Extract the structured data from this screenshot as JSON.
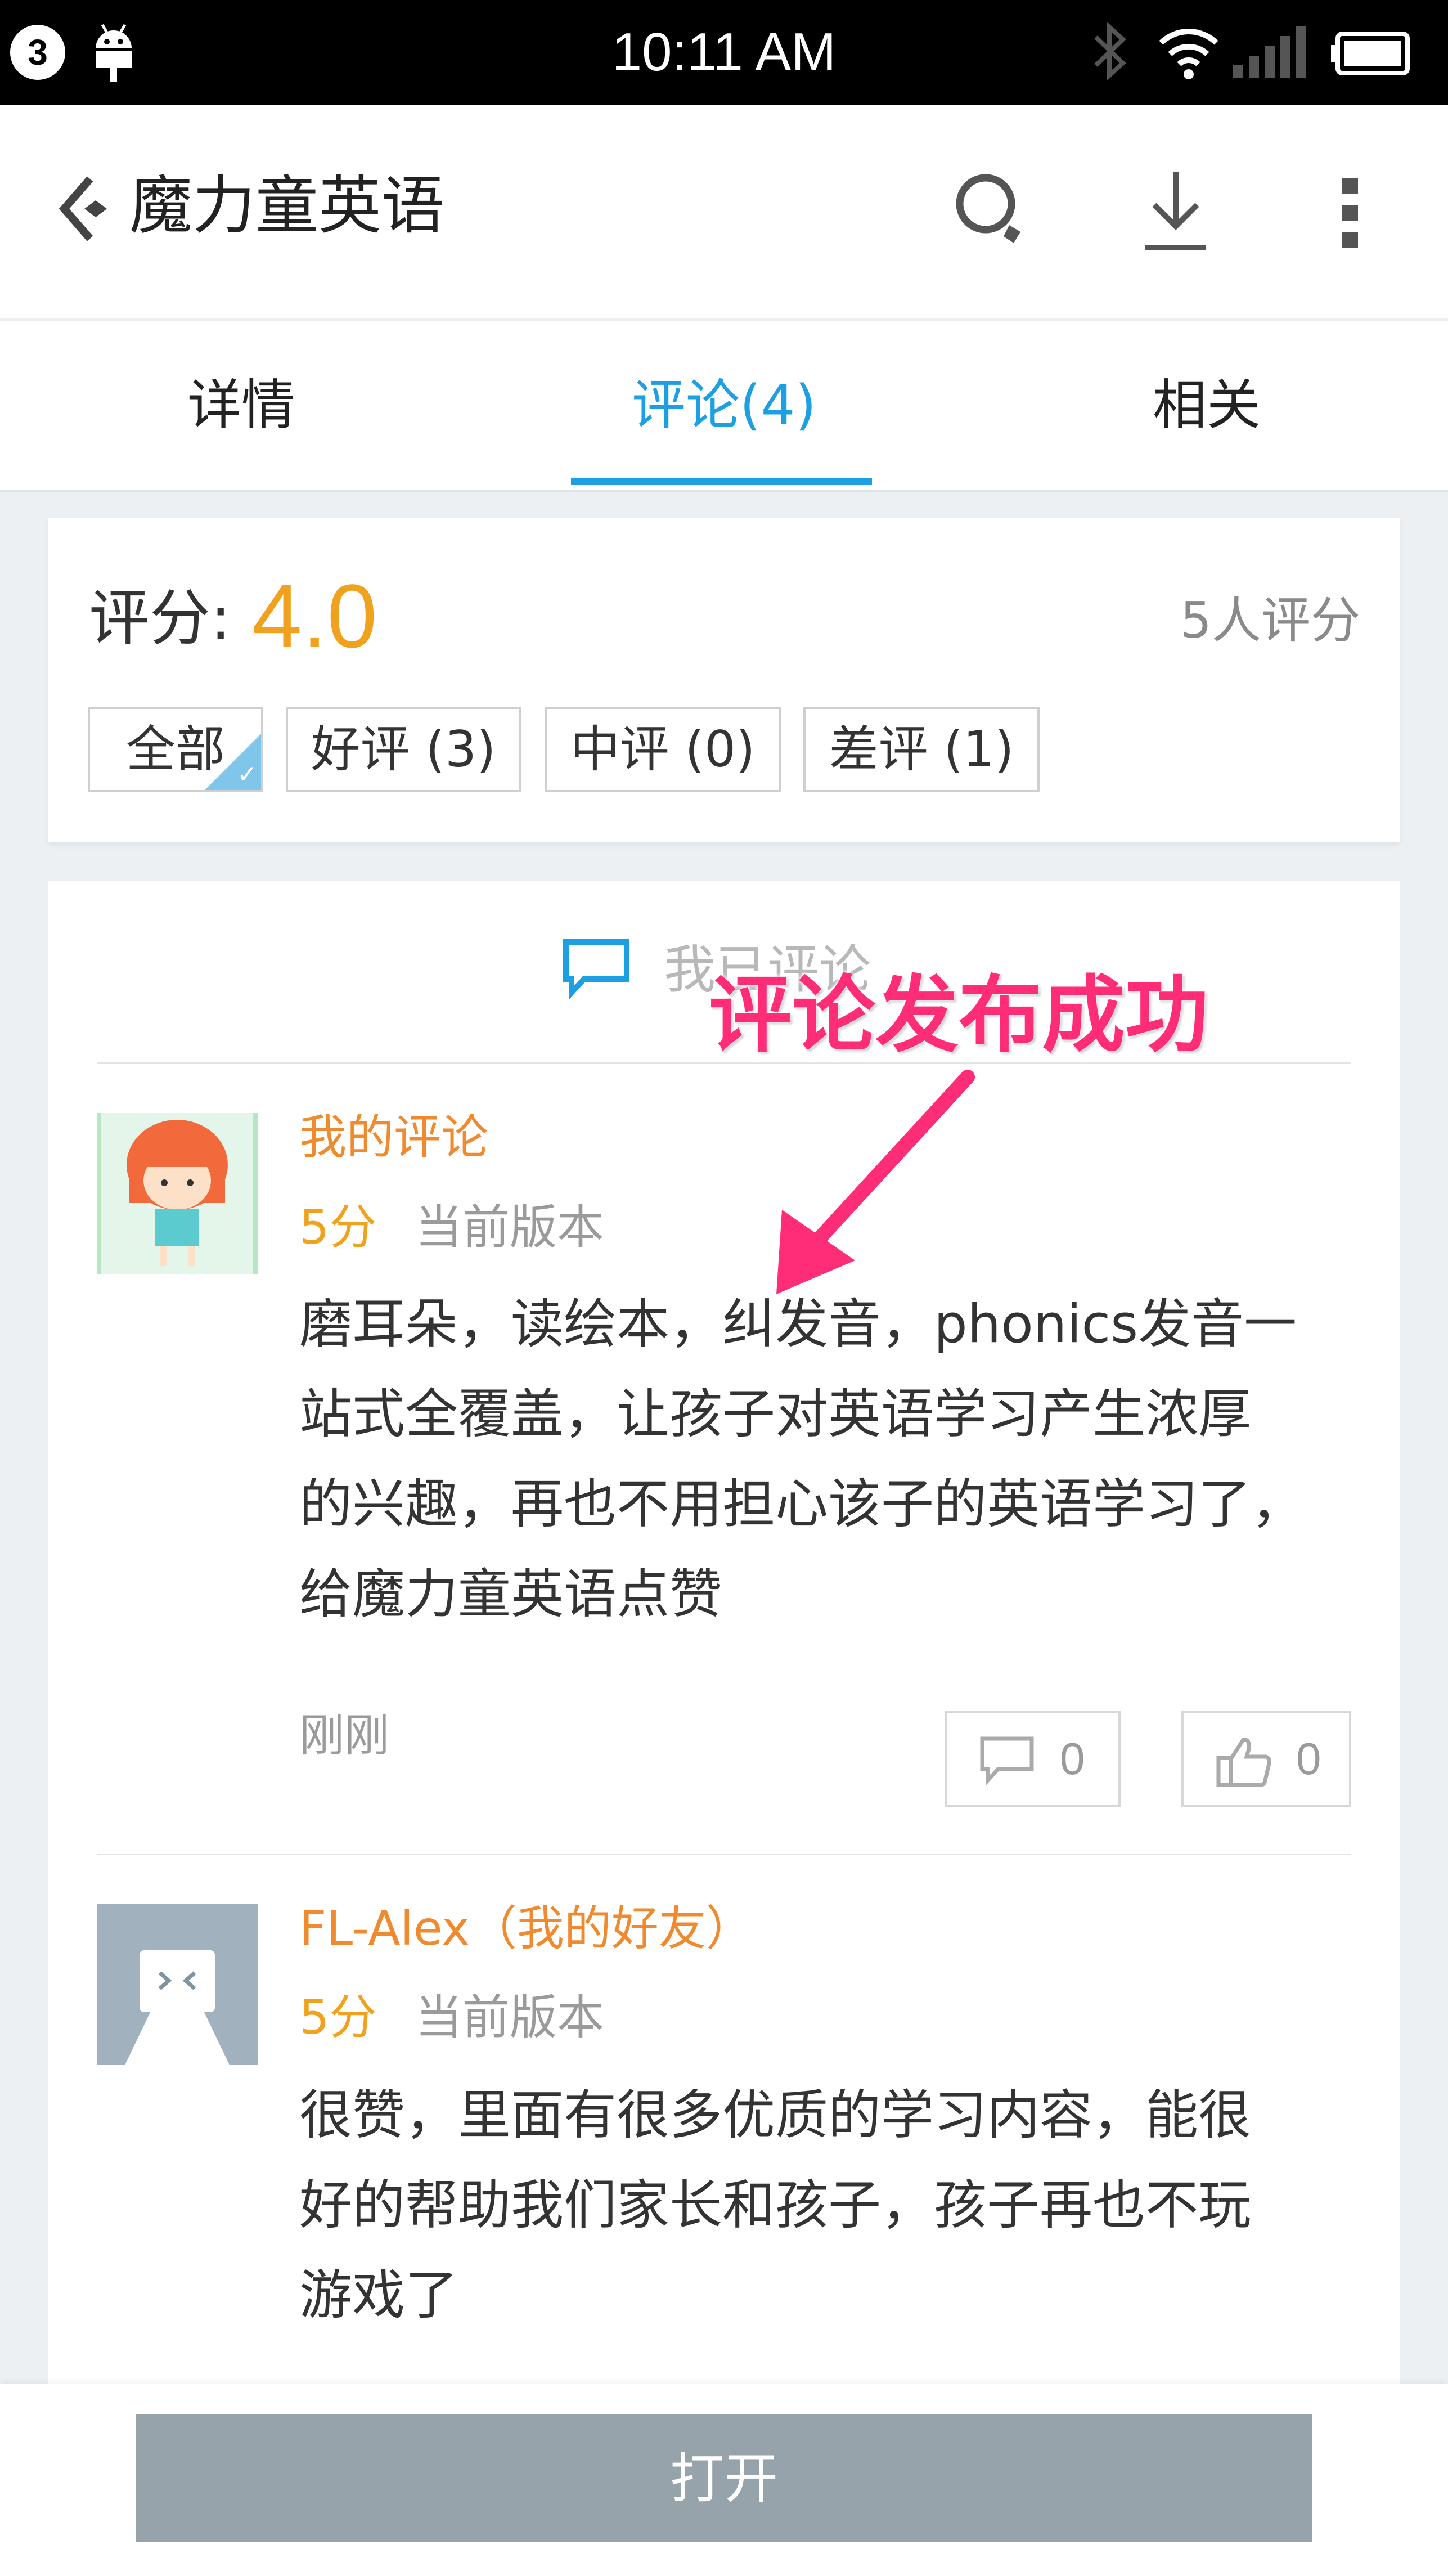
{
  "status_bar": {
    "notification_count": "3",
    "time": "10:11 AM",
    "icons": [
      "android-icon",
      "bluetooth-icon",
      "wifi-icon",
      "signal-icon",
      "battery-icon"
    ]
  },
  "app_bar": {
    "title": "魔力童英语",
    "icons": [
      "back-icon",
      "search-icon",
      "download-icon",
      "more-icon"
    ]
  },
  "tabs": [
    {
      "label": "详情"
    },
    {
      "label": "评论(4)",
      "active": true
    },
    {
      "label": "相关"
    }
  ],
  "rating": {
    "label": "评分:",
    "value": "4.0",
    "count_text": "5人评分",
    "filters": [
      {
        "label": "全部",
        "selected": true
      },
      {
        "label": "好评 (3)"
      },
      {
        "label": "中评 (0)"
      },
      {
        "label": "差评 (1)"
      }
    ]
  },
  "my_comment_link": "我已评论",
  "comments": [
    {
      "author": "我的评论",
      "score": "5分",
      "version": "当前版本",
      "lines": [
        "磨耳朵，读绘本，纠发音，phonics发音一",
        "站式全覆盖，让孩子对英语学习产生浓厚",
        "的兴趣，再也不用担心该子的英语学习了，",
        "给魔力童英语点赞"
      ],
      "time": "刚刚",
      "reply_count": "0",
      "like_count": "0"
    },
    {
      "author": "FL-Alex（我的好友）",
      "score": "5分",
      "version": "当前版本",
      "lines": [
        "很赞，里面有很多优质的学习内容，能很",
        "好的帮助我们家长和孩子，孩子再也不玩",
        "游戏了"
      ]
    }
  ],
  "annotation": "评论发布成功",
  "open_button": "打开",
  "colors": {
    "accent_blue": "#1ca0e3",
    "orange": "#f0a21e",
    "annotation_pink": "#ff2d78",
    "button_gray": "#97a3ab"
  }
}
